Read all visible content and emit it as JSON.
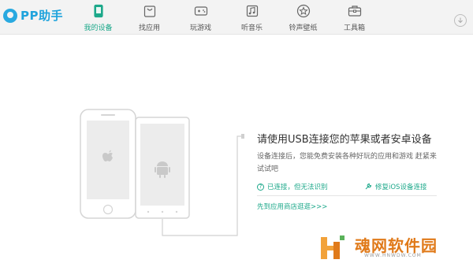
{
  "app": {
    "logo_text": "PP助手"
  },
  "nav": {
    "items": [
      {
        "label": "我的设备",
        "icon": "phone-icon",
        "active": true
      },
      {
        "label": "找应用",
        "icon": "app-bag-icon",
        "active": false
      },
      {
        "label": "玩游戏",
        "icon": "gamepad-icon",
        "active": false
      },
      {
        "label": "听音乐",
        "icon": "music-icon",
        "active": false
      },
      {
        "label": "铃声壁纸",
        "icon": "star-icon",
        "active": false
      },
      {
        "label": "工具箱",
        "icon": "toolbox-icon",
        "active": false
      }
    ]
  },
  "main": {
    "title": "请使用USB连接您的苹果或者安卓设备",
    "description": "设备连接后，您能免费安装各种好玩的应用和游戏 赶紧来试试吧",
    "link_connected_unrecognized": "已连接，但无法识别",
    "link_repair_ios": "修复iOS设备连接",
    "link_app_store": "先到应用商店逛逛>>>"
  },
  "watermark": {
    "text": "魂网软件园",
    "url": "WWW.HNWDW.COM"
  },
  "colors": {
    "accent": "#1ca88a",
    "brand": "#29a9e0",
    "watermark": "#e07a1a"
  }
}
